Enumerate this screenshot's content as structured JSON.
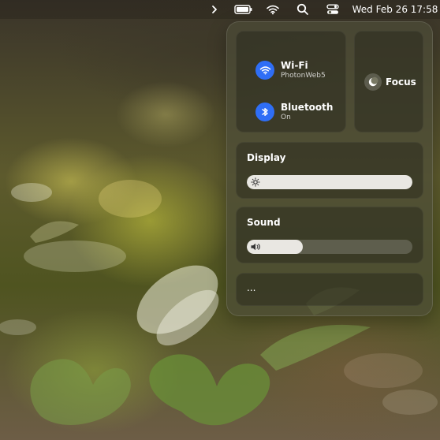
{
  "menu_bar": {
    "chevron_icon": "chevron-right-icon",
    "battery_icon": "battery-icon",
    "wifi_icon": "wifi-icon",
    "search_icon": "search-icon",
    "control_icon": "control-center-icon",
    "clock": "Wed Feb 26  17:58"
  },
  "control_center": {
    "wifi": {
      "title": "Wi-Fi",
      "subtitle": "PhotonWeb5",
      "icon": "wifi-icon"
    },
    "bluetooth": {
      "title": "Bluetooth",
      "subtitle": "On",
      "icon": "bluetooth-icon"
    },
    "focus": {
      "title": "Focus",
      "icon": "moon-icon"
    },
    "display": {
      "title": "Display",
      "icon": "brightness-icon",
      "level": 1.0
    },
    "sound": {
      "title": "Sound",
      "icon": "volume-icon",
      "level": 0.34
    },
    "more": {
      "label": "..."
    }
  },
  "colors": {
    "accent_blue": "#2f6ef6"
  }
}
